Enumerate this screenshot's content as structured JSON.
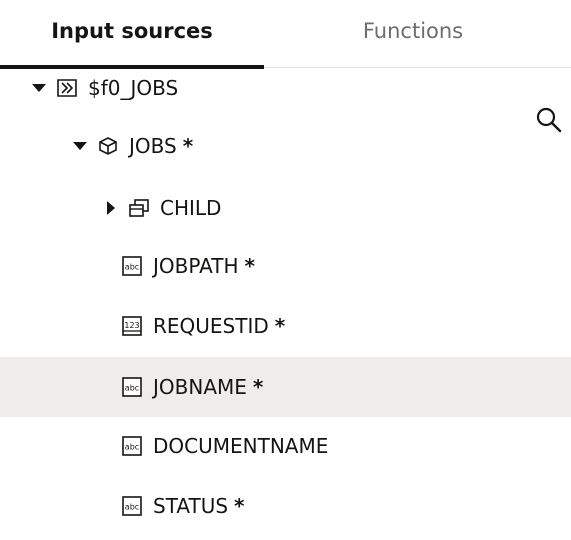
{
  "tabs": [
    {
      "label": "Input sources",
      "active": true
    },
    {
      "label": "Functions",
      "active": false
    }
  ],
  "tree": [
    {
      "label": "$f0_JOBS",
      "icon": "source-icon",
      "expander": "expanded",
      "required": ""
    },
    {
      "label": "JOBS",
      "icon": "object-icon",
      "expander": "expanded",
      "required": "*"
    },
    {
      "label": "CHILD",
      "icon": "collection-icon",
      "expander": "collapsed",
      "required": ""
    },
    {
      "label": "JOBPATH",
      "icon": "string-type-icon",
      "type_text": "abc",
      "required": "*"
    },
    {
      "label": "REQUESTID",
      "icon": "number-type-icon",
      "type_text": "123",
      "required": "*"
    },
    {
      "label": "JOBNAME",
      "icon": "string-type-icon",
      "type_text": "abc",
      "required": "*",
      "selected": true
    },
    {
      "label": "DOCUMENTNAME",
      "icon": "string-type-icon",
      "type_text": "abc",
      "required": ""
    },
    {
      "label": "STATUS",
      "icon": "string-type-icon",
      "type_text": "abc",
      "required": "*"
    }
  ],
  "colors": {
    "text": "#161513",
    "muted": "#6f6c69",
    "selected_row": "#efedeb",
    "divider": "#e4e1dd"
  }
}
